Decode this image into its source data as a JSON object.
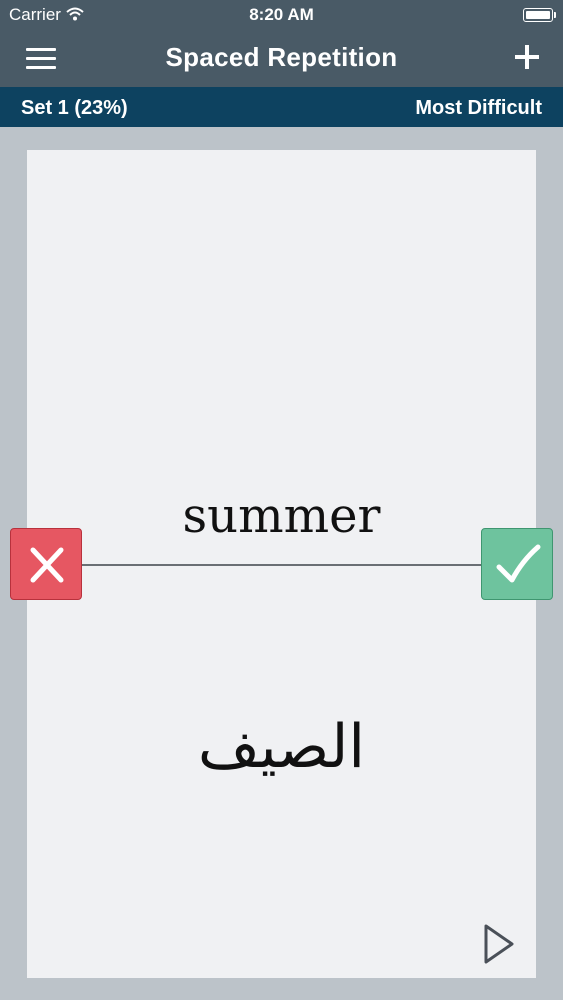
{
  "status_bar": {
    "carrier": "Carrier",
    "time": "8:20 AM",
    "wifi_icon": "wifi-icon",
    "battery_icon": "battery-icon"
  },
  "nav": {
    "title": "Spaced Repetition",
    "menu_icon": "hamburger-menu-icon",
    "add_icon": "plus-icon"
  },
  "set_bar": {
    "set_label": "Set 1 (23%)",
    "mode_label": "Most Difficult"
  },
  "card": {
    "front_word": "summer",
    "back_word": "الصيف"
  },
  "controls": {
    "wrong_icon": "x-icon",
    "right_icon": "check-icon",
    "play_icon": "play-icon"
  },
  "colors": {
    "nav_background": "#495a66",
    "set_bar_background": "#0d4260",
    "page_background": "#bcc3c9",
    "card_background": "#f0f1f3",
    "wrong_button": "#e65762",
    "right_button": "#6ec39e"
  }
}
